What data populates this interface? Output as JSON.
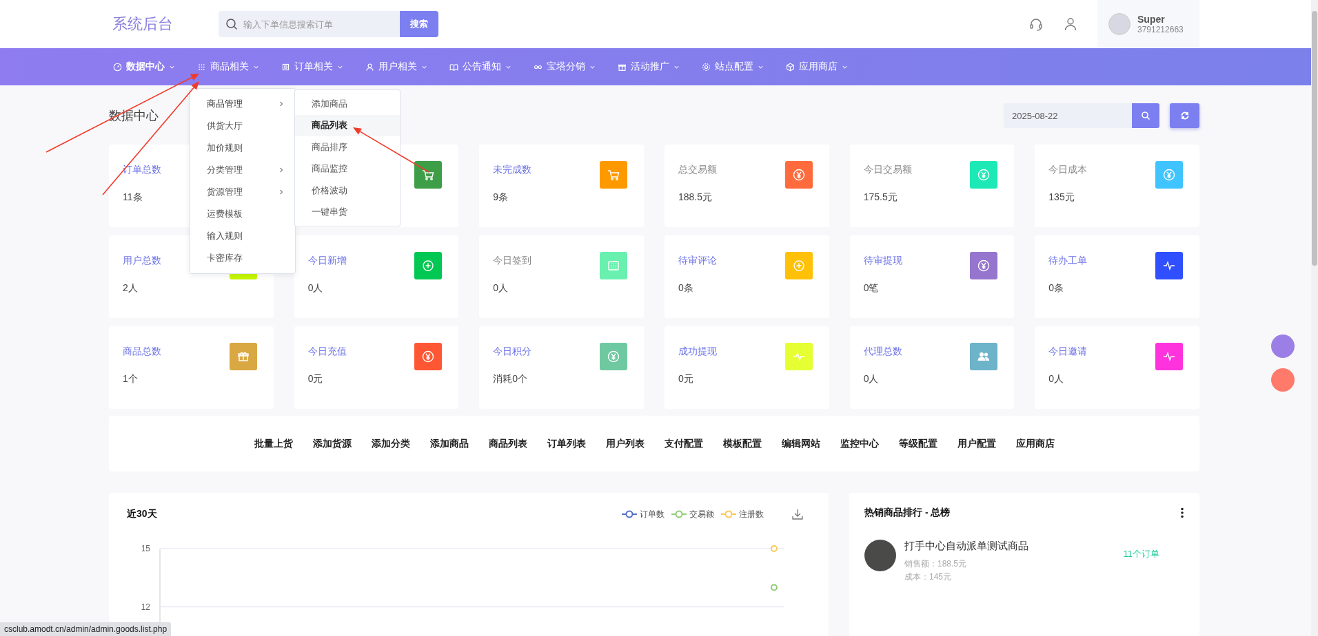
{
  "header": {
    "logo": "系统后台",
    "search": {
      "placeholder": "输入下单信息搜索订单",
      "button": "搜索"
    },
    "user": {
      "name": "Super",
      "id": "3791212663"
    }
  },
  "nav": [
    {
      "label": "数据中心",
      "selected": true
    },
    {
      "label": "商品相关",
      "selected": false
    },
    {
      "label": "订单相关",
      "selected": false
    },
    {
      "label": "用户相关",
      "selected": false
    },
    {
      "label": "公告通知",
      "selected": false
    },
    {
      "label": "宝塔分销",
      "selected": false
    },
    {
      "label": "活动推广",
      "selected": false
    },
    {
      "label": "站点配置",
      "selected": false
    },
    {
      "label": "应用商店",
      "selected": false
    }
  ],
  "dropdown": {
    "items": [
      {
        "label": "商品管理",
        "has_submenu": true,
        "expanded": true
      },
      {
        "label": "供货大厅",
        "has_submenu": false,
        "expanded": false
      },
      {
        "label": "加价规则",
        "has_submenu": false,
        "expanded": false
      },
      {
        "label": "分类管理",
        "has_submenu": true,
        "expanded": false
      },
      {
        "label": "货源管理",
        "has_submenu": true,
        "expanded": false
      },
      {
        "label": "运费模板",
        "has_submenu": false,
        "expanded": false
      },
      {
        "label": "输入规则",
        "has_submenu": false,
        "expanded": false
      },
      {
        "label": "卡密库存",
        "has_submenu": false,
        "expanded": false
      }
    ],
    "submenu": [
      {
        "label": "添加商品",
        "selected": false
      },
      {
        "label": "商品列表",
        "selected": true
      },
      {
        "label": "商品排序",
        "selected": false
      },
      {
        "label": "商品监控",
        "selected": false
      },
      {
        "label": "价格波动",
        "selected": false
      },
      {
        "label": "一键串货",
        "selected": false
      }
    ]
  },
  "page_title": "数据中心",
  "date": "2025-08-22",
  "stats": [
    {
      "title": "订单总数",
      "value": "11条",
      "accent": true
    },
    {
      "kind": "cart",
      "color": "#3d9e47"
    },
    {
      "title": "未完成数",
      "value": "9条",
      "accent": true,
      "kind": "cart",
      "color": "#ff9900"
    },
    {
      "title": "总交易额",
      "value": "188.5元",
      "accent": false,
      "kind": "yen",
      "color": "#ff6b3d"
    },
    {
      "title": "今日交易额",
      "value": "175.5元",
      "accent": false,
      "kind": "yen",
      "color": "#1de9b6"
    },
    {
      "title": "今日成本",
      "value": "135元",
      "accent": false,
      "kind": "yen",
      "color": "#40c4ff"
    },
    {
      "title": "用户总数",
      "value": "2人",
      "accent": true,
      "kind": "tray",
      "color": "#c6f700"
    },
    {
      "title": "今日新增",
      "value": "0人",
      "accent": true,
      "kind": "plus",
      "color": "#00c853"
    },
    {
      "title": "今日签到",
      "value": "0人",
      "accent": false,
      "kind": "grid",
      "color": "#69f0ae"
    },
    {
      "title": "待审评论",
      "value": "0条",
      "accent": true,
      "kind": "plus",
      "color": "#ffc107"
    },
    {
      "title": "待审提现",
      "value": "0笔",
      "accent": true,
      "kind": "yen",
      "color": "#9575cd"
    },
    {
      "title": "待办工单",
      "value": "0条",
      "accent": true,
      "kind": "pulse",
      "color": "#304ffe"
    },
    {
      "title": "商品总数",
      "value": "1个",
      "accent": true,
      "kind": "gift",
      "color": "#d9a843"
    },
    {
      "title": "今日充值",
      "value": "0元",
      "accent": true,
      "kind": "yen",
      "color": "#ff5733"
    },
    {
      "title": "今日积分",
      "value": "消耗0个",
      "accent": true,
      "kind": "yen",
      "color": "#6fc9a0"
    },
    {
      "title": "成功提现",
      "value": "0元",
      "accent": true,
      "kind": "pulse",
      "color": "#e5ff33"
    },
    {
      "title": "代理总数",
      "value": "0人",
      "accent": true,
      "kind": "users",
      "color": "#6db3c9"
    },
    {
      "title": "今日邀请",
      "value": "0人",
      "accent": true,
      "kind": "pulse",
      "color": "#ff33dd"
    }
  ],
  "shortcuts": [
    "批量上货",
    "添加货源",
    "添加分类",
    "添加商品",
    "商品列表",
    "订单列表",
    "用户列表",
    "支付配置",
    "模板配置",
    "编辑网站",
    "监控中心",
    "等级配置",
    "用户配置",
    "应用商店"
  ],
  "trend": {
    "title": "近30天",
    "chart_data": {
      "type": "line",
      "ylim": [
        10.5,
        15
      ],
      "yticks": [
        12,
        15
      ],
      "series": [
        {
          "name": "订单数",
          "color": "#5470c6",
          "marker": true,
          "values": [
            null,
            null,
            null,
            null,
            null,
            null,
            null,
            null,
            null,
            null,
            null,
            null,
            null,
            null,
            null,
            null,
            null,
            null,
            null,
            null,
            null,
            null,
            null,
            null,
            null,
            null,
            null,
            null,
            null,
            null
          ]
        },
        {
          "name": "交易额",
          "color": "#91cc75",
          "marker": true,
          "values": [
            null,
            null,
            null,
            null,
            null,
            null,
            null,
            null,
            null,
            null,
            null,
            null,
            null,
            null,
            null,
            null,
            null,
            null,
            null,
            null,
            null,
            null,
            null,
            null,
            null,
            null,
            null,
            null,
            null,
            13
          ]
        },
        {
          "name": "注册数",
          "color": "#fac858",
          "marker": true,
          "values": [
            null,
            null,
            null,
            null,
            null,
            null,
            null,
            null,
            null,
            null,
            null,
            null,
            null,
            null,
            null,
            null,
            null,
            null,
            null,
            null,
            null,
            null,
            null,
            null,
            null,
            null,
            null,
            null,
            null,
            15
          ]
        }
      ]
    }
  },
  "ranking": {
    "title": "热销商品排行 - 总榜",
    "items": [
      {
        "name": "打手中心自动派单测试商品",
        "sales": "销售额：188.5元",
        "cost": "成本：145元",
        "orders": "11个订单"
      }
    ]
  },
  "status_url": "csclub.amodt.cn/admin/admin.goods.list.php"
}
